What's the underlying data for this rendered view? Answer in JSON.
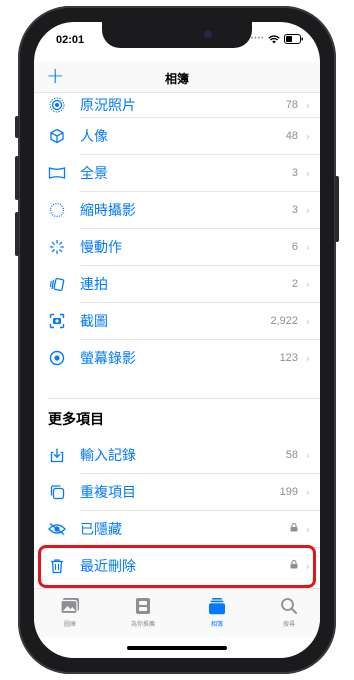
{
  "status": {
    "time": "02:01"
  },
  "nav": {
    "title": "相簿",
    "add_label": "+"
  },
  "rows": [
    {
      "label": "原況照片",
      "count": "78",
      "icon": "live-photo-icon"
    },
    {
      "label": "人像",
      "count": "48",
      "icon": "cube-icon"
    },
    {
      "label": "全景",
      "count": "3",
      "icon": "panorama-icon"
    },
    {
      "label": "縮時攝影",
      "count": "3",
      "icon": "timelapse-icon"
    },
    {
      "label": "慢動作",
      "count": "6",
      "icon": "slomo-icon"
    },
    {
      "label": "連拍",
      "count": "2",
      "icon": "burst-icon"
    },
    {
      "label": "截圖",
      "count": "2,922",
      "icon": "screenshot-icon"
    },
    {
      "label": "螢幕錄影",
      "count": "123",
      "icon": "screen-record-icon"
    }
  ],
  "more_section": {
    "title": "更多項目",
    "rows": [
      {
        "label": "輸入記錄",
        "count": "58",
        "icon": "import-icon"
      },
      {
        "label": "重複項目",
        "count": "199",
        "icon": "duplicate-icon"
      },
      {
        "label": "已隱藏",
        "count": "",
        "icon": "hidden-eye-icon",
        "locked": true
      },
      {
        "label": "最近刪除",
        "count": "",
        "icon": "trash-icon",
        "locked": true
      }
    ]
  },
  "tabs": [
    {
      "label": "圖庫",
      "icon": "library-icon"
    },
    {
      "label": "為你推薦",
      "icon": "for-you-icon"
    },
    {
      "label": "相簿",
      "icon": "albums-icon",
      "active": true
    },
    {
      "label": "搜尋",
      "icon": "search-icon"
    }
  ],
  "colors": {
    "accent": "#007aff",
    "highlight": "#e0161a",
    "secondary": "#8e8e93"
  }
}
